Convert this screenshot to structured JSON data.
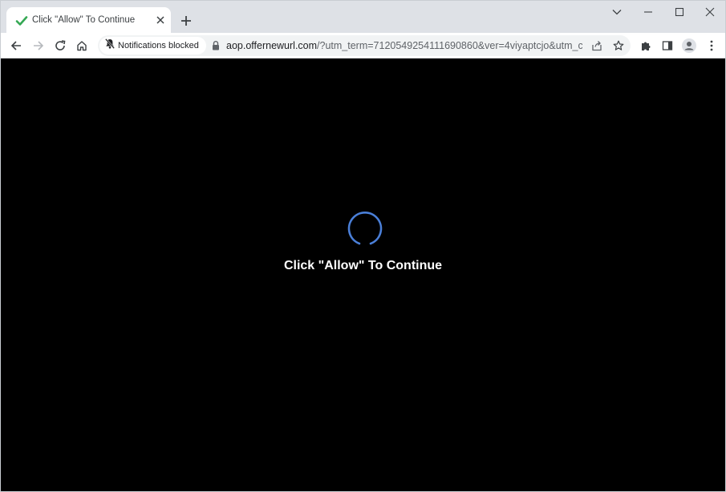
{
  "tab": {
    "title": "Click \"Allow\" To Continue",
    "favicon": "checkmark-icon",
    "favicon_color": "#34a853"
  },
  "toolbar": {
    "notification_chip_label": "Notifications blocked",
    "url_host": "aop.offernewurl.com",
    "url_rest": "/?utm_term=7120549254111690860&ver=4viyaptcjo&utm_co..."
  },
  "page": {
    "message": "Click \"Allow\" To Continue",
    "spinner_color": "#4a7fd8",
    "background": "#000000"
  },
  "icons": [
    "checkmark-icon",
    "close-icon",
    "plus-icon",
    "chevron-down-icon",
    "minimize-icon",
    "maximize-icon",
    "close-window-icon",
    "back-arrow-icon",
    "forward-arrow-icon",
    "reload-icon",
    "home-icon",
    "bell-off-icon",
    "lock-icon",
    "share-icon",
    "star-icon",
    "puzzle-icon",
    "side-panel-icon",
    "profile-icon",
    "kebab-menu-icon",
    "spinner-icon"
  ]
}
